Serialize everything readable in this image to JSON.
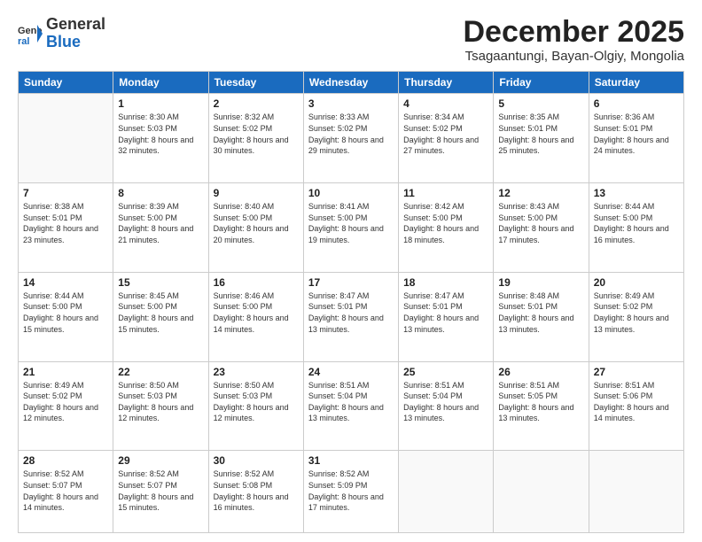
{
  "header": {
    "logo_general": "General",
    "logo_blue": "Blue",
    "month_title": "December 2025",
    "subtitle": "Tsagaantungi, Bayan-Olgiy, Mongolia"
  },
  "days_of_week": [
    "Sunday",
    "Monday",
    "Tuesday",
    "Wednesday",
    "Thursday",
    "Friday",
    "Saturday"
  ],
  "weeks": [
    [
      {
        "day": "",
        "sunrise": "",
        "sunset": "",
        "daylight": ""
      },
      {
        "day": "1",
        "sunrise": "Sunrise: 8:30 AM",
        "sunset": "Sunset: 5:03 PM",
        "daylight": "Daylight: 8 hours and 32 minutes."
      },
      {
        "day": "2",
        "sunrise": "Sunrise: 8:32 AM",
        "sunset": "Sunset: 5:02 PM",
        "daylight": "Daylight: 8 hours and 30 minutes."
      },
      {
        "day": "3",
        "sunrise": "Sunrise: 8:33 AM",
        "sunset": "Sunset: 5:02 PM",
        "daylight": "Daylight: 8 hours and 29 minutes."
      },
      {
        "day": "4",
        "sunrise": "Sunrise: 8:34 AM",
        "sunset": "Sunset: 5:02 PM",
        "daylight": "Daylight: 8 hours and 27 minutes."
      },
      {
        "day": "5",
        "sunrise": "Sunrise: 8:35 AM",
        "sunset": "Sunset: 5:01 PM",
        "daylight": "Daylight: 8 hours and 25 minutes."
      },
      {
        "day": "6",
        "sunrise": "Sunrise: 8:36 AM",
        "sunset": "Sunset: 5:01 PM",
        "daylight": "Daylight: 8 hours and 24 minutes."
      }
    ],
    [
      {
        "day": "7",
        "sunrise": "Sunrise: 8:38 AM",
        "sunset": "Sunset: 5:01 PM",
        "daylight": "Daylight: 8 hours and 23 minutes."
      },
      {
        "day": "8",
        "sunrise": "Sunrise: 8:39 AM",
        "sunset": "Sunset: 5:00 PM",
        "daylight": "Daylight: 8 hours and 21 minutes."
      },
      {
        "day": "9",
        "sunrise": "Sunrise: 8:40 AM",
        "sunset": "Sunset: 5:00 PM",
        "daylight": "Daylight: 8 hours and 20 minutes."
      },
      {
        "day": "10",
        "sunrise": "Sunrise: 8:41 AM",
        "sunset": "Sunset: 5:00 PM",
        "daylight": "Daylight: 8 hours and 19 minutes."
      },
      {
        "day": "11",
        "sunrise": "Sunrise: 8:42 AM",
        "sunset": "Sunset: 5:00 PM",
        "daylight": "Daylight: 8 hours and 18 minutes."
      },
      {
        "day": "12",
        "sunrise": "Sunrise: 8:43 AM",
        "sunset": "Sunset: 5:00 PM",
        "daylight": "Daylight: 8 hours and 17 minutes."
      },
      {
        "day": "13",
        "sunrise": "Sunrise: 8:44 AM",
        "sunset": "Sunset: 5:00 PM",
        "daylight": "Daylight: 8 hours and 16 minutes."
      }
    ],
    [
      {
        "day": "14",
        "sunrise": "Sunrise: 8:44 AM",
        "sunset": "Sunset: 5:00 PM",
        "daylight": "Daylight: 8 hours and 15 minutes."
      },
      {
        "day": "15",
        "sunrise": "Sunrise: 8:45 AM",
        "sunset": "Sunset: 5:00 PM",
        "daylight": "Daylight: 8 hours and 15 minutes."
      },
      {
        "day": "16",
        "sunrise": "Sunrise: 8:46 AM",
        "sunset": "Sunset: 5:00 PM",
        "daylight": "Daylight: 8 hours and 14 minutes."
      },
      {
        "day": "17",
        "sunrise": "Sunrise: 8:47 AM",
        "sunset": "Sunset: 5:01 PM",
        "daylight": "Daylight: 8 hours and 13 minutes."
      },
      {
        "day": "18",
        "sunrise": "Sunrise: 8:47 AM",
        "sunset": "Sunset: 5:01 PM",
        "daylight": "Daylight: 8 hours and 13 minutes."
      },
      {
        "day": "19",
        "sunrise": "Sunrise: 8:48 AM",
        "sunset": "Sunset: 5:01 PM",
        "daylight": "Daylight: 8 hours and 13 minutes."
      },
      {
        "day": "20",
        "sunrise": "Sunrise: 8:49 AM",
        "sunset": "Sunset: 5:02 PM",
        "daylight": "Daylight: 8 hours and 13 minutes."
      }
    ],
    [
      {
        "day": "21",
        "sunrise": "Sunrise: 8:49 AM",
        "sunset": "Sunset: 5:02 PM",
        "daylight": "Daylight: 8 hours and 12 minutes."
      },
      {
        "day": "22",
        "sunrise": "Sunrise: 8:50 AM",
        "sunset": "Sunset: 5:03 PM",
        "daylight": "Daylight: 8 hours and 12 minutes."
      },
      {
        "day": "23",
        "sunrise": "Sunrise: 8:50 AM",
        "sunset": "Sunset: 5:03 PM",
        "daylight": "Daylight: 8 hours and 12 minutes."
      },
      {
        "day": "24",
        "sunrise": "Sunrise: 8:51 AM",
        "sunset": "Sunset: 5:04 PM",
        "daylight": "Daylight: 8 hours and 13 minutes."
      },
      {
        "day": "25",
        "sunrise": "Sunrise: 8:51 AM",
        "sunset": "Sunset: 5:04 PM",
        "daylight": "Daylight: 8 hours and 13 minutes."
      },
      {
        "day": "26",
        "sunrise": "Sunrise: 8:51 AM",
        "sunset": "Sunset: 5:05 PM",
        "daylight": "Daylight: 8 hours and 13 minutes."
      },
      {
        "day": "27",
        "sunrise": "Sunrise: 8:51 AM",
        "sunset": "Sunset: 5:06 PM",
        "daylight": "Daylight: 8 hours and 14 minutes."
      }
    ],
    [
      {
        "day": "28",
        "sunrise": "Sunrise: 8:52 AM",
        "sunset": "Sunset: 5:07 PM",
        "daylight": "Daylight: 8 hours and 14 minutes."
      },
      {
        "day": "29",
        "sunrise": "Sunrise: 8:52 AM",
        "sunset": "Sunset: 5:07 PM",
        "daylight": "Daylight: 8 hours and 15 minutes."
      },
      {
        "day": "30",
        "sunrise": "Sunrise: 8:52 AM",
        "sunset": "Sunset: 5:08 PM",
        "daylight": "Daylight: 8 hours and 16 minutes."
      },
      {
        "day": "31",
        "sunrise": "Sunrise: 8:52 AM",
        "sunset": "Sunset: 5:09 PM",
        "daylight": "Daylight: 8 hours and 17 minutes."
      },
      {
        "day": "",
        "sunrise": "",
        "sunset": "",
        "daylight": ""
      },
      {
        "day": "",
        "sunrise": "",
        "sunset": "",
        "daylight": ""
      },
      {
        "day": "",
        "sunrise": "",
        "sunset": "",
        "daylight": ""
      }
    ]
  ]
}
